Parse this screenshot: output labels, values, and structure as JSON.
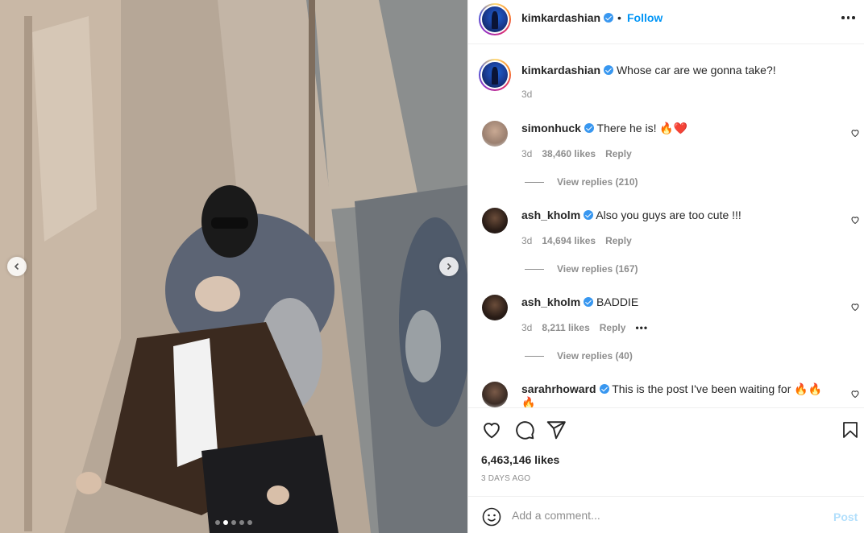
{
  "post": {
    "username": "kimkardashian",
    "follow_label": "Follow",
    "separator": "•",
    "caption": "Whose car are we gonna take?!",
    "caption_time": "3d",
    "likes": "6,463,146 likes",
    "posted_ago": "3 DAYS AGO",
    "carousel": {
      "count": 5,
      "active_index": 1
    }
  },
  "comments": [
    {
      "username": "simonhuck",
      "text": "There he is! 🔥❤️",
      "time": "3d",
      "likes": "38,460 likes",
      "reply_label": "Reply",
      "view_replies": "View replies (210)"
    },
    {
      "username": "ash_kholm",
      "text": "Also you guys are too cute !!!",
      "time": "3d",
      "likes": "14,694 likes",
      "reply_label": "Reply",
      "view_replies": "View replies (167)"
    },
    {
      "username": "ash_kholm",
      "text": "BADDIE",
      "time": "3d",
      "likes": "8,211 likes",
      "reply_label": "Reply",
      "view_replies": "View replies (40)"
    },
    {
      "username": "sarahrhoward",
      "text": "This is the post I've been waiting for 🔥🔥",
      "text2": "🔥"
    }
  ],
  "add_comment": {
    "placeholder": "Add a comment...",
    "post_label": "Post"
  },
  "icons": {
    "verified": "verified-badge-icon",
    "more": "more-options-icon",
    "like": "heart-icon",
    "comment": "comment-icon",
    "share": "share-icon",
    "save": "bookmark-icon",
    "emoji": "emoji-icon",
    "prev": "chevron-left-icon",
    "next": "chevron-right-icon"
  },
  "colors": {
    "link_blue": "#0095f6",
    "verified_blue": "#3897f0",
    "muted": "#8e8e8e",
    "post_disabled": "#b2dffc"
  }
}
